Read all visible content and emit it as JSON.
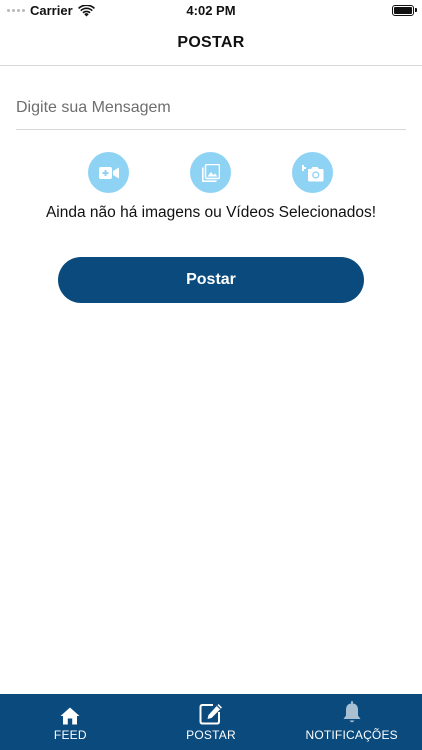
{
  "status_bar": {
    "carrier": "Carrier",
    "time": "4:02 PM"
  },
  "header": {
    "title": "POSTAR"
  },
  "composer": {
    "message_placeholder": "Digite sua Mensagem",
    "message_value": "",
    "media_buttons": [
      {
        "icon": "video-add-icon"
      },
      {
        "icon": "gallery-icon"
      },
      {
        "icon": "camera-add-icon"
      }
    ],
    "empty_media_text": "Ainda não há imagens ou Vídeos Selecionados!",
    "post_button_label": "Postar"
  },
  "tab_bar": {
    "items": [
      {
        "label": "FEED",
        "icon": "home-icon"
      },
      {
        "label": "POSTAR",
        "icon": "edit-icon"
      },
      {
        "label": "NOTIFICAÇÕES",
        "icon": "bell-icon"
      }
    ]
  },
  "colors": {
    "primary": "#0a4a7d",
    "media_button": "#8fd3f4"
  }
}
